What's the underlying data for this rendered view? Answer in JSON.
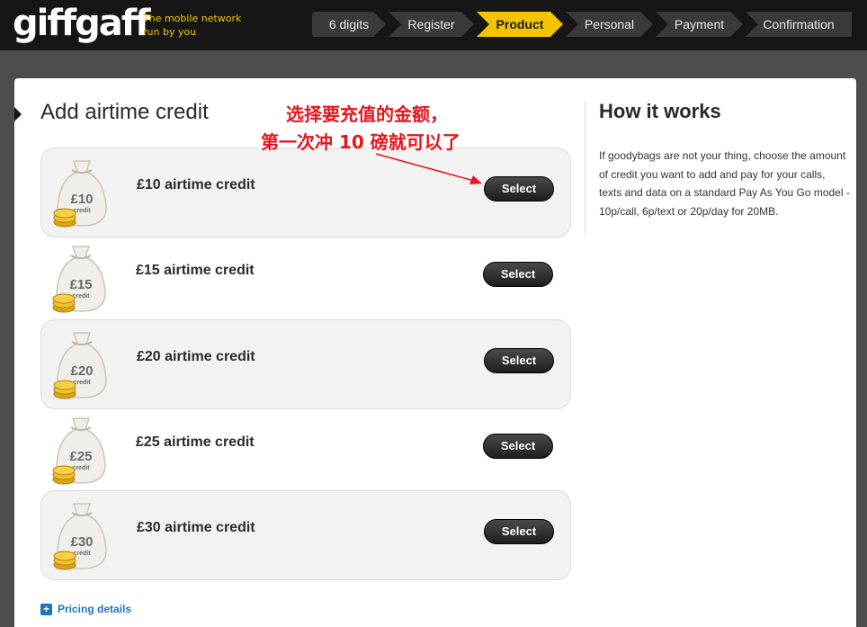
{
  "header": {
    "logo": "giffgaff",
    "tagline_line1": "The mobile network",
    "tagline_line2": "run by you"
  },
  "steps": [
    {
      "label": "6 digits",
      "active": false
    },
    {
      "label": "Register",
      "active": false
    },
    {
      "label": "Product",
      "active": true
    },
    {
      "label": "Personal",
      "active": false
    },
    {
      "label": "Payment",
      "active": false
    },
    {
      "label": "Confirmation",
      "active": false
    }
  ],
  "main": {
    "title": "Add airtime credit",
    "annotation_line1": "选择要充值的金额，",
    "annotation_line2": "第一次冲 10 磅就可以了",
    "credits": [
      {
        "amount": "£10",
        "bag_sub": "credit",
        "label": "£10 airtime credit",
        "button": "Select"
      },
      {
        "amount": "£15",
        "bag_sub": "credit",
        "label": "£15 airtime credit",
        "button": "Select"
      },
      {
        "amount": "£20",
        "bag_sub": "credit",
        "label": "£20 airtime credit",
        "button": "Select"
      },
      {
        "amount": "£25",
        "bag_sub": "credit",
        "label": "£25 airtime credit",
        "button": "Select"
      },
      {
        "amount": "£30",
        "bag_sub": "credit",
        "label": "£30 airtime credit",
        "button": "Select"
      }
    ],
    "pricing_link": "Pricing details"
  },
  "sidebar": {
    "title": "How it works",
    "text": "If goodybags are not your thing, choose the amount of credit you want to add and pay for your calls, texts and data on a standard Pay As You Go model - 10p/call, 6p/text or 20p/day for 20MB."
  },
  "colors": {
    "accent": "#f5c400",
    "annotation": "#e8141c",
    "link": "#1e73be"
  }
}
